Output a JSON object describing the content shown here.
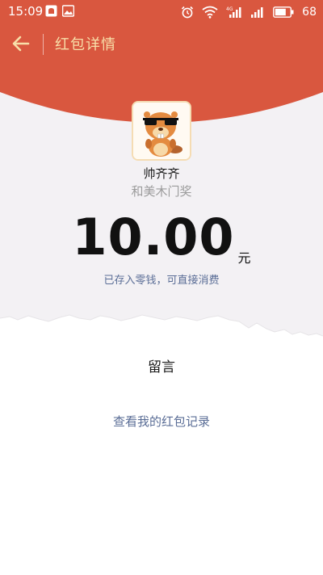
{
  "status_bar": {
    "time": "15:09",
    "battery": "68",
    "left_icons": [
      "notification-icon",
      "gallery-icon"
    ],
    "right_icons": [
      "alarm-icon",
      "wifi-icon",
      "signal-4g-icon",
      "signal-icon",
      "battery-icon"
    ]
  },
  "nav": {
    "title": "红包详情",
    "back_icon": "back-arrow-icon"
  },
  "packet": {
    "sender_name": "帅齐齐",
    "blessing": "和美木门奖",
    "amount": "10.00",
    "unit": "元",
    "deposit_note": "已存入零钱，可直接消费"
  },
  "message": {
    "label": "留言"
  },
  "links": {
    "history": "查看我的红包记录"
  },
  "colors": {
    "header_red": "#d9573f",
    "title_gold": "#f8dfa9",
    "link_blue": "#5a6d96",
    "page_gray": "#f3f1f4"
  }
}
